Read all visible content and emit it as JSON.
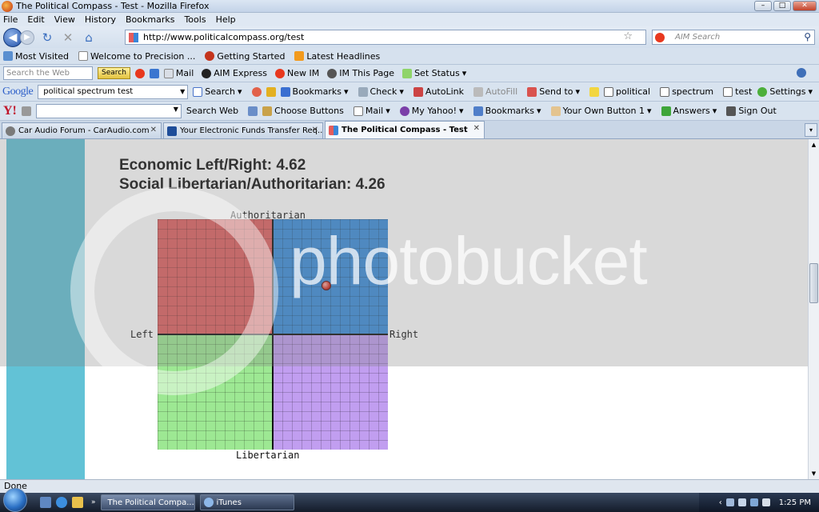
{
  "window": {
    "title": "The Political Compass - Test - Mozilla Firefox"
  },
  "menu": [
    "File",
    "Edit",
    "View",
    "History",
    "Bookmarks",
    "Tools",
    "Help"
  ],
  "nav": {
    "url": "http://www.politicalcompass.org/test",
    "search_placeholder": "AIM Search"
  },
  "bookmarks": [
    "Most Visited",
    "Welcome to Precision ...",
    "Getting Started",
    "Latest Headlines"
  ],
  "aim_toolbar": {
    "search_placeholder": "Search the Web",
    "search_button": "Search",
    "items": [
      "Mail",
      "AIM Express",
      "New IM",
      "IM This Page",
      "Set Status"
    ]
  },
  "google_toolbar": {
    "logo": "Google",
    "query": "political spectrum test",
    "search_label": "Search",
    "items": [
      "Bookmarks",
      "Check",
      "AutoLink",
      "AutoFill",
      "Send to",
      "political",
      "spectrum",
      "test"
    ],
    "settings_label": "Settings"
  },
  "yahoo_toolbar": {
    "logo": "Y!",
    "items": [
      "Search Web",
      "Choose Buttons",
      "Mail",
      "My Yahoo!",
      "Bookmarks",
      "Your Own Button 1",
      "Answers",
      "Sign Out"
    ]
  },
  "tabs": [
    {
      "label": "Car Audio Forum - CarAudio.com",
      "active": false
    },
    {
      "label": "Your Electronic Funds Transfer Req...",
      "active": false
    },
    {
      "label": "The Political Compass - Test",
      "active": true
    }
  ],
  "page": {
    "economic_line": "Economic Left/Right: 4.62",
    "social_line": "Social Libertarian/Authoritarian: 4.26",
    "compass": {
      "label_top": "Authoritarian",
      "label_bottom": "Libertarian",
      "label_left": "Left",
      "label_right": "Right",
      "economic": 4.62,
      "social": 4.26,
      "range": [
        -10,
        10
      ],
      "colors": {
        "top_left": "#e06060",
        "top_right": "#3a8ddc",
        "bottom_left": "#9de893",
        "bottom_right": "#c19ef0",
        "dot": "#d22417"
      }
    },
    "watermark": "photobucket"
  },
  "status": {
    "text": "Done"
  },
  "taskbar": {
    "tasks": [
      "The Political Compa...",
      "iTunes"
    ],
    "clock": "1:25 PM"
  }
}
